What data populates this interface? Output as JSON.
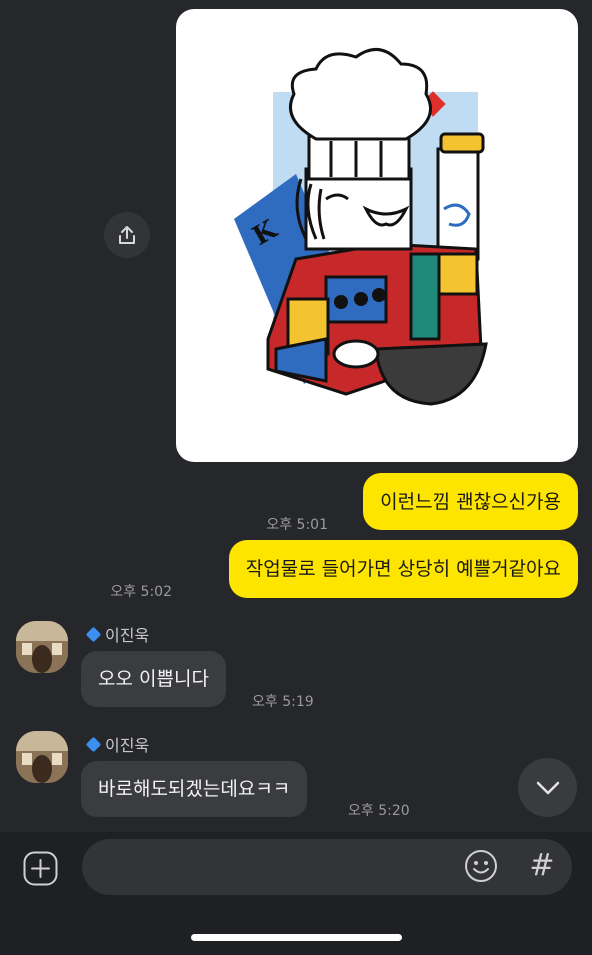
{
  "messages": {
    "sent_1": {
      "text": "이런느낌 괜찮으신가용",
      "time": "오후 5:01"
    },
    "sent_2": {
      "text": "작업물로 들어가면 상당히 예쁠거같아요",
      "time": "오후 5:02"
    },
    "recv_1": {
      "sender": "이진욱",
      "text": "오오 이쁩니다",
      "time": "오후 5:19"
    },
    "recv_2": {
      "sender": "이진욱",
      "text": "바로해도되겠는데요ㅋㅋ",
      "time": "오후 5:20"
    }
  },
  "image": {
    "card_letter": "K"
  },
  "input": {
    "placeholder": "",
    "hash_label": "#"
  },
  "colors": {
    "my_bubble": "#fee500",
    "their_bubble": "#3b3c40",
    "background": "#26272b",
    "badge": "#3b8ff0"
  },
  "icons": {
    "share": "share-icon",
    "plus": "plus-icon",
    "emoji": "emoji-icon",
    "scroll_down": "chevron-down-icon"
  }
}
